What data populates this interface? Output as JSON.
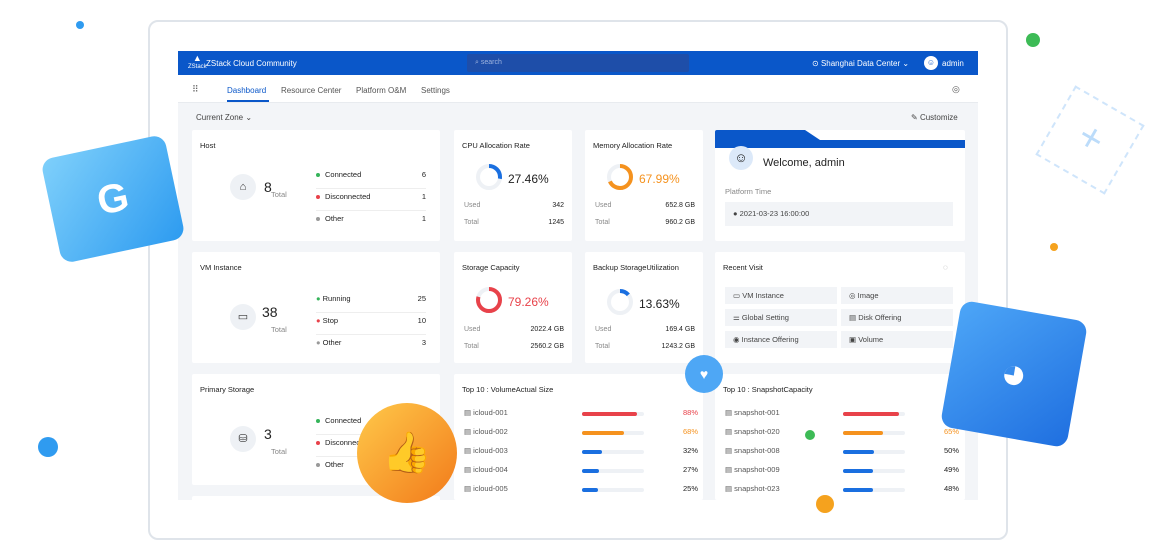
{
  "app": {
    "title": "ZStack Cloud Community",
    "logo_text": "ZStack",
    "search_placeholder": "search",
    "datacenter": "Shanghai Data Center",
    "user": "admin"
  },
  "nav": {
    "tabs": [
      "Dashboard",
      "Resource Center",
      "Platform O&M",
      "Settings"
    ],
    "active": "Dashboard"
  },
  "toolbar": {
    "zone": "Current Zone",
    "customize": "Customize"
  },
  "host": {
    "title": "Host",
    "total": "8",
    "total_label": "Total",
    "legend": [
      {
        "label": "Connected",
        "value": "6",
        "color": "#35b45a"
      },
      {
        "label": "Disconnected",
        "value": "1",
        "color": "#e8424a"
      },
      {
        "label": "Other",
        "value": "1",
        "color": "#999999"
      }
    ]
  },
  "cpu": {
    "title": "CPU Allocation Rate",
    "percent": "27.46%",
    "fraction": 0.2746,
    "color": "#1a6fe0",
    "used_label": "Used",
    "used": "342",
    "total_label": "Total",
    "total": "1245"
  },
  "memory": {
    "title": "Memory Allocation Rate",
    "percent": "67.99%",
    "fraction": 0.6799,
    "color": "#f5921e",
    "used_label": "Used",
    "used": "652.8 GB",
    "total_label": "Total",
    "total": "960.2 GB"
  },
  "welcome": {
    "greeting": "Welcome, admin",
    "time_label": "Platform Time",
    "time": "2021-03-23 16:00:00"
  },
  "vm": {
    "title": "VM Instance",
    "total": "38",
    "total_label": "Total",
    "legend": [
      {
        "label": "Running",
        "value": "25",
        "color": "#35b45a"
      },
      {
        "label": "Stop",
        "value": "10",
        "color": "#e8424a"
      },
      {
        "label": "Other",
        "value": "3",
        "color": "#999999"
      }
    ]
  },
  "storage": {
    "title": "Storage Capacity",
    "percent": "79.26%",
    "fraction": 0.7926,
    "color": "#e8424a",
    "used_label": "Used",
    "used": "2022.4 GB",
    "total_label": "Total",
    "total": "2560.2 GB"
  },
  "backup": {
    "title": "Backup StorageUtilization",
    "percent": "13.63%",
    "fraction": 0.1363,
    "color": "#1a6fe0",
    "used_label": "Used",
    "used": "169.4 GB",
    "total_label": "Total",
    "total": "1243.2 GB"
  },
  "recent": {
    "title": "Recent Visit",
    "items": [
      {
        "label": "VM Instance",
        "icon": "▭"
      },
      {
        "label": "Image",
        "icon": "◎"
      },
      {
        "label": "Global Setting",
        "icon": "⚌"
      },
      {
        "label": "Disk Offering",
        "icon": "▤"
      },
      {
        "label": "Instance Offering",
        "icon": "◉"
      },
      {
        "label": "Volume",
        "icon": "▣"
      }
    ]
  },
  "primary": {
    "title": "Primary Storage",
    "total": "3",
    "total_label": "Total",
    "legend": [
      {
        "label": "Connected",
        "color": "#35b45a"
      },
      {
        "label": "Disconnected",
        "color": "#e8424a"
      },
      {
        "label": "Other",
        "color": "#999999"
      }
    ]
  },
  "volumes": {
    "title": "Top 10 : VolumeActual Size",
    "rows": [
      {
        "name": "icloud-001",
        "pct": "88%",
        "fraction": 0.88,
        "color": "#e8424a"
      },
      {
        "name": "icloud-002",
        "pct": "68%",
        "fraction": 0.68,
        "color": "#f5921e"
      },
      {
        "name": "icloud-003",
        "pct": "32%",
        "fraction": 0.32,
        "color": "#1a6fe0"
      },
      {
        "name": "icloud-004",
        "pct": "27%",
        "fraction": 0.27,
        "color": "#1a6fe0"
      },
      {
        "name": "icloud-005",
        "pct": "25%",
        "fraction": 0.25,
        "color": "#1a6fe0"
      }
    ]
  },
  "snapshots": {
    "title": "Top 10 : SnapshotCapacity",
    "rows": [
      {
        "name": "snapshot-001",
        "pct": "90%",
        "fraction": 0.9,
        "color": "#e8424a"
      },
      {
        "name": "snapshot-020",
        "pct": "65%",
        "fraction": 0.65,
        "color": "#f5921e"
      },
      {
        "name": "snapshot-008",
        "pct": "50%",
        "fraction": 0.5,
        "color": "#1a6fe0"
      },
      {
        "name": "snapshot-009",
        "pct": "49%",
        "fraction": 0.49,
        "color": "#1a6fe0"
      },
      {
        "name": "snapshot-023",
        "pct": "48%",
        "fraction": 0.48,
        "color": "#1a6fe0"
      }
    ]
  }
}
